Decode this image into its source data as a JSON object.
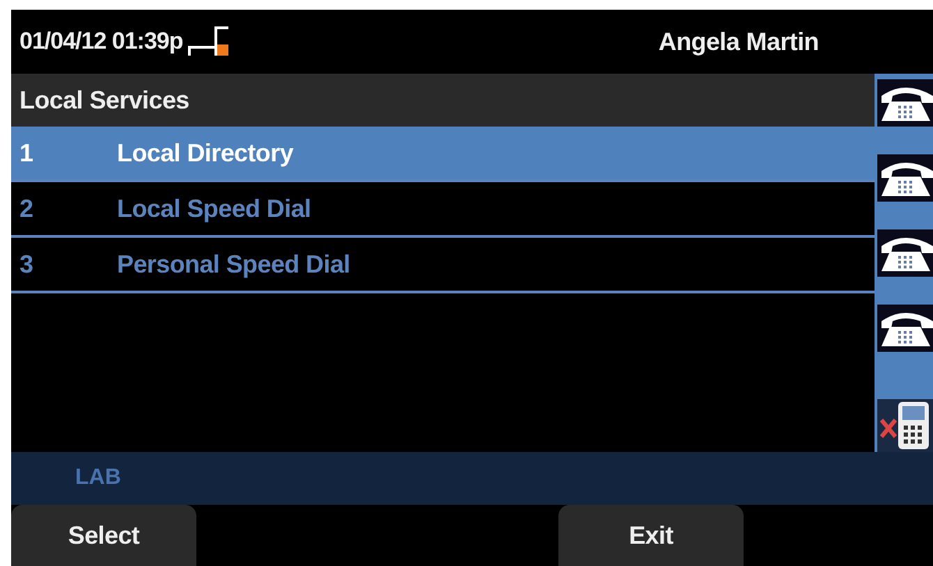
{
  "header": {
    "datetime": "01/04/12 01:39p",
    "user": "Angela Martin"
  },
  "title": "Local Services",
  "items": [
    {
      "number": "1",
      "label": "Local Directory",
      "selected": true
    },
    {
      "number": "2",
      "label": "Local Speed Dial",
      "selected": false
    },
    {
      "number": "3",
      "label": "Personal Speed Dial",
      "selected": false
    }
  ],
  "line_buttons": [
    {
      "kind": "phone"
    },
    {
      "kind": "phone"
    },
    {
      "kind": "phone"
    },
    {
      "kind": "phone"
    },
    {
      "kind": "mobile"
    }
  ],
  "status": "LAB",
  "softkeys": [
    {
      "label": "Select"
    },
    {
      "label": "Exit"
    }
  ]
}
